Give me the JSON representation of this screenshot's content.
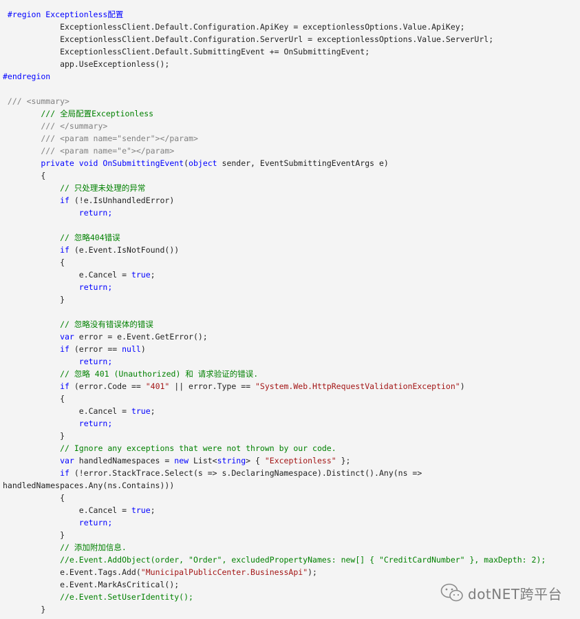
{
  "colors": {
    "background": "#f4f4f4",
    "keyword": "#0000ff",
    "string": "#a31515",
    "comment": "#008000",
    "type": "#2b91af",
    "doc_comment": "#808080",
    "text": "#222222"
  },
  "code_lines": [
    [
      [
        "reg",
        " #region Exceptionless配置"
      ]
    ],
    [
      [
        "txt",
        "            ExceptionlessClient.Default.Configuration.ApiKey = exceptionlessOptions.Value.ApiKey;"
      ]
    ],
    [
      [
        "txt",
        "            ExceptionlessClient.Default.Configuration.ServerUrl = exceptionlessOptions.Value.ServerUrl;"
      ]
    ],
    [
      [
        "txt",
        "            ExceptionlessClient.Default.SubmittingEvent += OnSubmittingEvent;"
      ]
    ],
    [
      [
        "txt",
        "            app.UseExceptionless();"
      ]
    ],
    [
      [
        "reg",
        "#endregion"
      ]
    ],
    [
      [
        "txt",
        ""
      ]
    ],
    [
      [
        "doc",
        " /// <summary>"
      ]
    ],
    [
      [
        "com",
        "        /// 全局配置Exceptionless"
      ]
    ],
    [
      [
        "doc",
        "        /// </summary>"
      ]
    ],
    [
      [
        "doc",
        "        /// <param name=\"sender\"></param>"
      ]
    ],
    [
      [
        "doc",
        "        /// <param name=\"e\"></param>"
      ]
    ],
    [
      [
        "kw",
        "        private void "
      ],
      [
        "kw",
        "OnSubmittingEvent"
      ],
      [
        "txt",
        "("
      ],
      [
        "kw",
        "object"
      ],
      [
        "txt",
        " sender, EventSubmittingEventArgs e)"
      ]
    ],
    [
      [
        "txt",
        "        {"
      ]
    ],
    [
      [
        "com",
        "            // 只处理未处理的异常"
      ]
    ],
    [
      [
        "kw",
        "            if"
      ],
      [
        "txt",
        " (!e.IsUnhandledError)"
      ]
    ],
    [
      [
        "kw",
        "                return;"
      ]
    ],
    [
      [
        "txt",
        ""
      ]
    ],
    [
      [
        "com",
        "            // 忽略404错误"
      ]
    ],
    [
      [
        "kw",
        "            if"
      ],
      [
        "txt",
        " (e.Event.IsNotFound())"
      ]
    ],
    [
      [
        "txt",
        "            {"
      ]
    ],
    [
      [
        "txt",
        "                e.Cancel = "
      ],
      [
        "kw",
        "true"
      ],
      [
        "txt",
        ";"
      ]
    ],
    [
      [
        "kw",
        "                return;"
      ]
    ],
    [
      [
        "txt",
        "            }"
      ]
    ],
    [
      [
        "txt",
        ""
      ]
    ],
    [
      [
        "com",
        "            // 忽略没有错误体的错误"
      ]
    ],
    [
      [
        "kw",
        "            var"
      ],
      [
        "txt",
        " error = e.Event.GetError();"
      ]
    ],
    [
      [
        "kw",
        "            if"
      ],
      [
        "txt",
        " (error == "
      ],
      [
        "kw",
        "null"
      ],
      [
        "txt",
        ")"
      ]
    ],
    [
      [
        "kw",
        "                return;"
      ]
    ],
    [
      [
        "com",
        "            // 忽略 401 (Unauthorized) 和 请求验证的错误."
      ]
    ],
    [
      [
        "kw",
        "            if"
      ],
      [
        "txt",
        " (error.Code == "
      ],
      [
        "str",
        "\"401\""
      ],
      [
        "txt",
        " || error.Type == "
      ],
      [
        "str",
        "\"System.Web.HttpRequestValidationException\""
      ],
      [
        "txt",
        ")"
      ]
    ],
    [
      [
        "txt",
        "            {"
      ]
    ],
    [
      [
        "txt",
        "                e.Cancel = "
      ],
      [
        "kw",
        "true"
      ],
      [
        "txt",
        ";"
      ]
    ],
    [
      [
        "kw",
        "                return;"
      ]
    ],
    [
      [
        "txt",
        "            }"
      ]
    ],
    [
      [
        "com",
        "            // Ignore any exceptions that were not thrown by our code."
      ]
    ],
    [
      [
        "kw",
        "            var"
      ],
      [
        "txt",
        " handledNamespaces = "
      ],
      [
        "kw",
        "new"
      ],
      [
        "txt",
        " List<"
      ],
      [
        "kw",
        "string"
      ],
      [
        "txt",
        "> { "
      ],
      [
        "str",
        "\"Exceptionless\""
      ],
      [
        "txt",
        " };"
      ]
    ],
    [
      [
        "kw",
        "            if"
      ],
      [
        "txt",
        " (!error.StackTrace.Select(s => s.DeclaringNamespace).Distinct().Any(ns =>"
      ]
    ],
    [
      [
        "txt",
        "handledNamespaces.Any(ns.Contains)))"
      ]
    ],
    [
      [
        "txt",
        "            {"
      ]
    ],
    [
      [
        "txt",
        "                e.Cancel = "
      ],
      [
        "kw",
        "true"
      ],
      [
        "txt",
        ";"
      ]
    ],
    [
      [
        "kw",
        "                return;"
      ]
    ],
    [
      [
        "txt",
        "            }"
      ]
    ],
    [
      [
        "com",
        "            // 添加附加信息."
      ]
    ],
    [
      [
        "com",
        "            //e.Event.AddObject(order, \"Order\", excludedPropertyNames: new[] { \"CreditCardNumber\" }, maxDepth: 2);"
      ]
    ],
    [
      [
        "txt",
        "            e.Event.Tags.Add("
      ],
      [
        "str",
        "\"MunicipalPublicCenter.BusinessApi\""
      ],
      [
        "txt",
        ");"
      ]
    ],
    [
      [
        "txt",
        "            e.Event.MarkAsCritical();"
      ]
    ],
    [
      [
        "com",
        "            //e.Event.SetUserIdentity();"
      ]
    ],
    [
      [
        "txt",
        "        }"
      ]
    ]
  ],
  "watermark": {
    "text": "dotNET跨平台",
    "icon": "wechat-icon"
  }
}
